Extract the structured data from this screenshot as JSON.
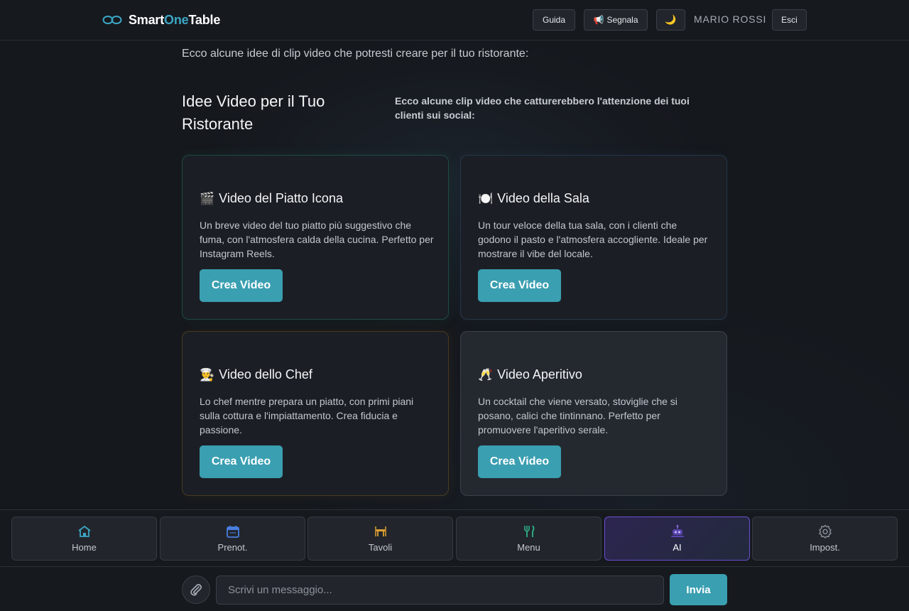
{
  "header": {
    "brand_part1": "Smart",
    "brand_part2": "One",
    "brand_part3": "Table",
    "guide_label": "Guida",
    "report_emoji": "📢",
    "report_label": "Segnala",
    "theme_icon": "🌙",
    "user_name": "MARIO ROSSI",
    "logout_label": "Esci"
  },
  "content": {
    "intro": "Ecco alcune idee di clip video che potresti creare per il tuo ristorante:",
    "title": "Idee Video per il Tuo Ristorante",
    "subtitle": "Ecco alcune clip video che catturerebbero l'attenzione dei tuoi clienti sui social:",
    "cards": [
      {
        "emoji": "🎬",
        "title": "Video del Piatto Icona",
        "desc": "Un breve video del tuo piatto più suggestivo che fuma, con l'atmosfera calda della cucina. Perfetto per Instagram Reels.",
        "button": "Crea Video"
      },
      {
        "emoji": "🍽️",
        "title": "Video della Sala",
        "desc": "Un tour veloce della tua sala, con i clienti che godono il pasto e l'atmosfera accogliente. Ideale per mostrare il vibe del locale.",
        "button": "Crea Video"
      },
      {
        "emoji": "👨‍🍳",
        "title": "Video dello Chef",
        "desc": "Lo chef mentre prepara un piatto, con primi piani sulla cottura e l'impiattamento. Crea fiducia e passione.",
        "button": "Crea Video"
      },
      {
        "emoji": "🥂",
        "title": "Video Aperitivo",
        "desc": "Un cocktail che viene versato, stoviglie che si posano, calici che tintinnano. Perfetto per promuovere l'aperitivo serale.",
        "button": "Crea Video"
      }
    ]
  },
  "nav": {
    "items": [
      {
        "label": "Home",
        "icon": "home-icon",
        "color": "#3ba7c4"
      },
      {
        "label": "Prenot.",
        "icon": "calendar-icon",
        "color": "#4a7de0"
      },
      {
        "label": "Tavoli",
        "icon": "table-icon",
        "color": "#e0a030"
      },
      {
        "label": "Menu",
        "icon": "fork-knife-icon",
        "color": "#2fb38a"
      },
      {
        "label": "AI",
        "icon": "robot-icon",
        "color": "#8a6be8"
      },
      {
        "label": "Impost.",
        "icon": "gear-icon",
        "color": "#8b9199"
      }
    ],
    "active_index": 4
  },
  "chat": {
    "placeholder": "Scrivi un messaggio...",
    "send_label": "Invia"
  }
}
